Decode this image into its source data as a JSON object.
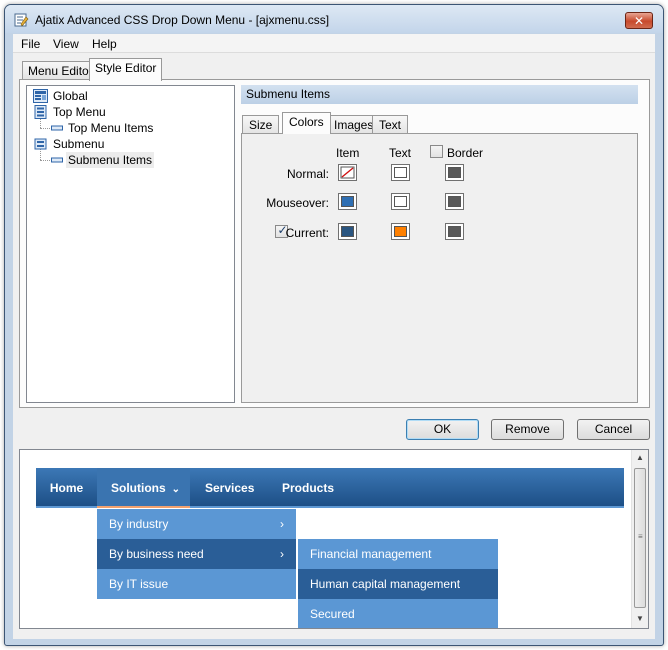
{
  "window": {
    "title": "Ajatix Advanced CSS Drop Down Menu - [ajxmenu.css]",
    "close_glyph": "✕"
  },
  "menubar": {
    "items": [
      "File",
      "View",
      "Help"
    ]
  },
  "main_tabs": [
    "Menu Editor",
    "Style Editor"
  ],
  "tree": {
    "items": [
      {
        "label": "Global",
        "icon": "global-style-icon"
      },
      {
        "label": "Top Menu",
        "icon": "top-menu-icon"
      },
      {
        "label": "Top Menu Items",
        "icon": "menu-items-icon"
      },
      {
        "label": "Submenu",
        "icon": "submenu-icon"
      },
      {
        "label": "Submenu Items",
        "icon": "menu-items-icon"
      }
    ],
    "selected": "Submenu Items"
  },
  "section_title": "Submenu Items",
  "subtabs": [
    "Size",
    "Colors",
    "Images",
    "Text"
  ],
  "colors": {
    "columns": {
      "item": "Item",
      "text": "Text",
      "border": "Border"
    },
    "border_checked": false,
    "rows": {
      "normal": {
        "label": "Normal:",
        "item": "none",
        "text": "#ffffff",
        "border": "#595959"
      },
      "mouseover": {
        "label": "Mouseover:",
        "item": "#2f6fb3",
        "text": "#ffffff",
        "border": "#595959"
      },
      "current": {
        "label": "Current:",
        "checked": true,
        "item": "#2a5580",
        "text": "#ff8000",
        "border": "#595959"
      }
    }
  },
  "buttons": {
    "ok": "OK",
    "remove": "Remove",
    "cancel": "Cancel"
  },
  "preview": {
    "nav": [
      "Home",
      "Solutions",
      "Services",
      "Products"
    ],
    "active_nav": "Solutions",
    "submenu": [
      "By industry",
      "By business need",
      "By IT issue"
    ],
    "subsubmenu": [
      "Financial management",
      "Human capital management",
      "Secured"
    ],
    "arrow_glyph": "›",
    "chevron_glyph": "⌄"
  }
}
